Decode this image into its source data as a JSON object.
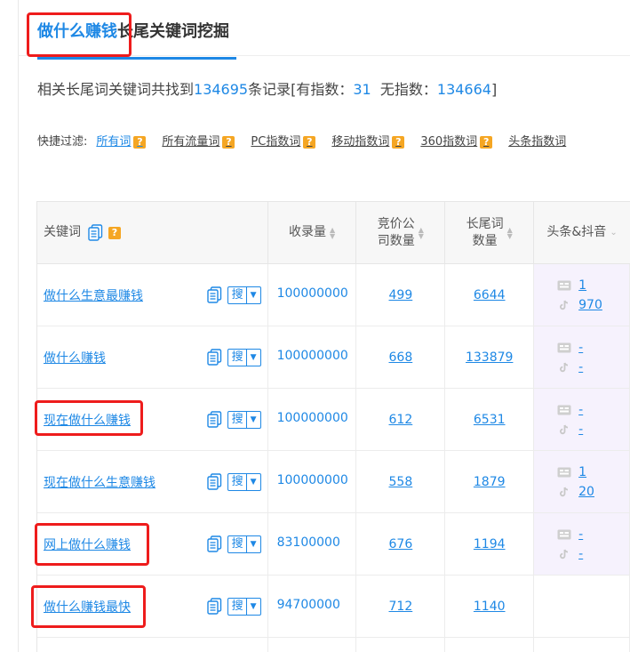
{
  "title": {
    "highlight": "做什么赚钱",
    "rest": "长尾关键词挖掘"
  },
  "summary": {
    "prefix": "相关长尾词关键词共找到",
    "total": "134695",
    "mid1": "条记录[有指数：",
    "with_index": "31",
    "mid2": "  无指数：",
    "without_index": "134664",
    "suffix": "]"
  },
  "filters": {
    "label": "快捷过滤:",
    "items": [
      {
        "label": "所有词"
      },
      {
        "label": "所有流量词"
      },
      {
        "label": "PC指数词"
      },
      {
        "label": "移动指数词"
      },
      {
        "label": "360指数词"
      },
      {
        "label": "头条指数词"
      }
    ]
  },
  "table": {
    "headers": {
      "keyword": "关键词",
      "indexed": "收录量",
      "bid_line1": "竞价公",
      "bid_line2": "司数量",
      "longtail_line1": "长尾词",
      "longtail_line2": "数量",
      "toutiao": "头条&抖音"
    },
    "search_label": "搜",
    "rows": [
      {
        "keyword": "做什么生意最赚钱",
        "indexed": "100000000",
        "bid": "499",
        "longtail": "6644",
        "toutiao": "1",
        "douyin": "970"
      },
      {
        "keyword": "做什么赚钱",
        "indexed": "100000000",
        "bid": "668",
        "longtail": "133879",
        "toutiao": "-",
        "douyin": "-"
      },
      {
        "keyword": "现在做什么赚钱",
        "indexed": "100000000",
        "bid": "612",
        "longtail": "6531",
        "toutiao": "-",
        "douyin": "-"
      },
      {
        "keyword": "现在做什么生意赚钱",
        "indexed": "100000000",
        "bid": "558",
        "longtail": "1879",
        "toutiao": "1",
        "douyin": "20"
      },
      {
        "keyword": "网上做什么赚钱",
        "indexed": "83100000",
        "bid": "676",
        "longtail": "1194",
        "toutiao": "-",
        "douyin": "-"
      },
      {
        "keyword": "做什么赚钱最快",
        "indexed": "94700000",
        "bid": "712",
        "longtail": "1140",
        "toutiao": "",
        "douyin": ""
      }
    ]
  },
  "colors": {
    "accent": "#1e88e5",
    "annotation": "#ee1c1c",
    "help_icon": "#f5a623",
    "platform_bg": "#f6f2fd"
  },
  "icons": {
    "help": "?",
    "copy": "copy-icon",
    "toutiao": "toutiao-icon",
    "douyin": "douyin-icon",
    "sort": "sort-icon"
  }
}
